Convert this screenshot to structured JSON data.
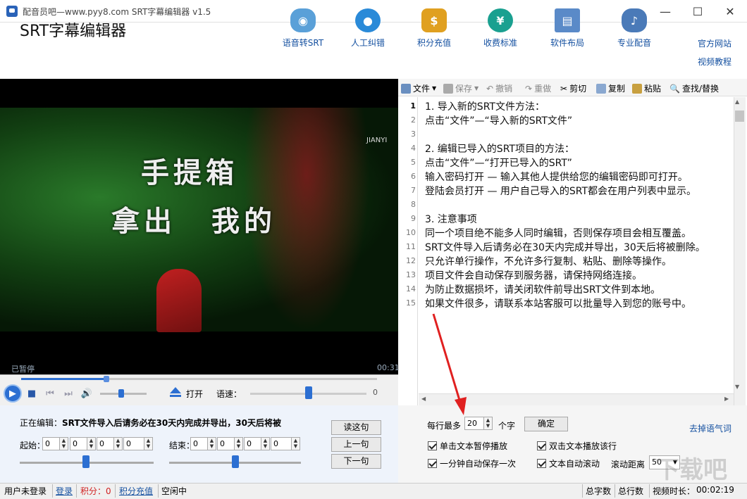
{
  "window": {
    "title": "配音员吧—www.pyy8.com SRT字幕编辑器 v1.5",
    "minimize": "—",
    "maximize": "☐",
    "close": "✕"
  },
  "header": {
    "app_name": "SRT字幕编辑器",
    "tools": [
      {
        "label": "语音转SRT",
        "icon": "robot-icon",
        "color": "#5aa0d8"
      },
      {
        "label": "人工纠错",
        "icon": "user-icon",
        "color": "#2a8ad8"
      },
      {
        "label": "积分充值",
        "icon": "coins-icon",
        "color": "#e0a020"
      },
      {
        "label": "收费标准",
        "icon": "yen-icon",
        "color": "#1aa090"
      },
      {
        "label": "软件布局",
        "icon": "layout-icon",
        "color": "#5a8ac8"
      },
      {
        "label": "专业配音",
        "icon": "microphone-icon",
        "color": "#4a7ab8"
      }
    ],
    "links": {
      "official_site": "官方网站",
      "video_tutorial": "视频教程"
    }
  },
  "video": {
    "subtitle_line1": "手提箱",
    "subtitle_line2a": "拿出",
    "subtitle_line2b": "我的",
    "watermark": "JIANYI",
    "status": "已暂停",
    "time": "00:31"
  },
  "player": {
    "progress": 0.24,
    "volume": 0.45,
    "open_label": "打开",
    "speed_label": "语速：",
    "speed_value": "0",
    "speed_position": 0.5
  },
  "editing": {
    "prefix": "正在编辑：",
    "text": "SRT文件导入后请务必在30天内完成并导出，30天后将被",
    "start_label": "起始：",
    "end_label": "结束：",
    "start": [
      "0",
      "0",
      "0",
      "0"
    ],
    "end": [
      "0",
      "0",
      "0",
      "0"
    ],
    "read_button": "读这句",
    "prev_button": "上一句",
    "next_button": "下一句"
  },
  "toolbar": {
    "file": "文件",
    "save": "保存",
    "undo": "撤销",
    "redo": "重做",
    "cut": "剪切",
    "copy": "复制",
    "paste": "粘贴",
    "find": "查找/替换"
  },
  "editor": {
    "line_numbers": [
      "1",
      "2",
      "3",
      "4",
      "5",
      "6",
      "7",
      "8",
      "9",
      "10",
      "11",
      "12",
      "13",
      "14",
      "15"
    ],
    "lines": [
      "1. 导入新的SRT文件方法：",
      "点击“文件”—“导入新的SRT文件”",
      "",
      "2. 编辑已导入的SRT项目的方法：",
      "点击“文件”—“打开已导入的SRT”",
      "输入密码打开 — 输入其他人提供给您的编辑密码即可打开。",
      "登陆会员打开 — 用户自己导入的SRT都会在用户列表中显示。",
      "",
      "3. 注意事项",
      "同一个项目绝不能多人同时编辑，否则保存项目会相互覆盖。",
      "SRT文件导入后请务必在30天内完成并导出，30天后将被删除。",
      "只允许单行操作，不允许多行复制、粘贴、删除等操作。",
      "项目文件会自动保存到服务器，请保持网络连接。",
      "为防止数据损坏，请关闭软件前导出SRT文件到本地。",
      "如果文件很多，请联系本站客服可以批量导入到您的账号中。"
    ]
  },
  "settings": {
    "max_per_line_label": "每行最多",
    "max_per_line_value": "20",
    "unit": "个字",
    "confirm": "确定",
    "remove_filler": "去掉语气词",
    "cb_pause_single_click": "单击文本暂停播放",
    "cb_play_double_click": "双击文本播放该行",
    "cb_autosave": "一分钟自动保存一次",
    "cb_autoscroll": "文本自动滚动",
    "scroll_distance_label": "滚动距离",
    "scroll_distance_value": "50"
  },
  "status": {
    "user": "用户未登录",
    "login": "登录",
    "points": "积分：0",
    "recharge": "积分充值",
    "state": "空闲中",
    "total_chars": "总字数",
    "total_lines": "总行数",
    "duration_label": "视频时长：",
    "duration": "00:02:19"
  },
  "site_watermark": "下载吧",
  "colors": {
    "accent": "#2c6fd2",
    "link": "#1450a0",
    "arrow": "#e02020"
  }
}
